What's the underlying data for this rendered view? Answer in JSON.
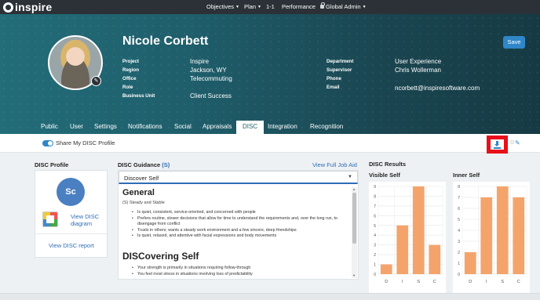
{
  "nav": {
    "logo": "inspire",
    "items": [
      {
        "label": "Objectives",
        "caret": true
      },
      {
        "label": "Plan",
        "caret": true
      },
      {
        "label": "1-1",
        "caret": false
      },
      {
        "label": "Performance",
        "caret": false
      },
      {
        "label": "Global Admin",
        "caret": true
      }
    ]
  },
  "profile": {
    "name": "Nicole Corbett",
    "fields_left": [
      {
        "label": "Project",
        "value": "Inspire"
      },
      {
        "label": "Region",
        "value": "Jackson, WY"
      },
      {
        "label": "Office",
        "value": "Telecommuting"
      },
      {
        "label": "Role",
        "value": ""
      },
      {
        "label": "Business Unit",
        "value": "Client Success"
      }
    ],
    "fields_right": [
      {
        "label": "Department",
        "value": "User Experience"
      },
      {
        "label": "Supervisor",
        "value": "Chris Wollerman"
      },
      {
        "label": "Phone",
        "value": ""
      },
      {
        "label": "Email",
        "value": "ncorbett@inspiresoftware.com"
      }
    ],
    "save_label": "Save"
  },
  "tabs": [
    {
      "label": "Public",
      "active": false
    },
    {
      "label": "User",
      "active": false
    },
    {
      "label": "Settings",
      "active": false
    },
    {
      "label": "Notifications",
      "active": false
    },
    {
      "label": "Social",
      "active": false
    },
    {
      "label": "Appraisals",
      "active": false
    },
    {
      "label": "DISC",
      "active": true
    },
    {
      "label": "Integration",
      "active": false
    },
    {
      "label": "Recognition",
      "active": false
    }
  ],
  "toolbar": {
    "share_label": "Share My DISC Profile",
    "share_on": true,
    "download_icon": "download-icon",
    "edit_icon": "pencil-icon"
  },
  "disc_profile": {
    "title": "DISC Profile",
    "badge": "Sc",
    "view_diagram": "View DISC diagram",
    "view_report": "View DISC report"
  },
  "guidance": {
    "title": "DISC Guidance",
    "title_suffix": "(S)",
    "view_full": "View Full Job Aid",
    "selected": "Discover Self",
    "general_heading": "General",
    "general_sub": "(S) Steady and Stable",
    "general_bullets": [
      "Is quiet, consistent, service-oriented, and concerned with people",
      "Prefers routine, slower decisions that allow for time to understand the requirements and, over the long run, to disengage from conflict",
      "Trusts in others; wants a steady work environment and a few sincere, deep friendships",
      "Is quiet, relaxed, and attentive with facial expressions and body movements"
    ],
    "discovering_heading": "DISCovering Self",
    "discovering_bullets": [
      "Your strength is primarily in situations requiring follow-through",
      "You feel most stress in situations involving loss of predictability"
    ]
  },
  "results": {
    "title": "DISC Results",
    "bar_color": "#f4a46b"
  },
  "chart_data": [
    {
      "type": "bar",
      "title": "Visible Self",
      "categories": [
        "D",
        "I",
        "S",
        "C"
      ],
      "values": [
        1,
        5,
        9,
        3
      ],
      "ylim": [
        0,
        9
      ],
      "yticks": [
        0,
        1,
        2,
        3,
        4,
        5,
        6,
        7,
        8,
        9
      ],
      "grid": true
    },
    {
      "type": "bar",
      "title": "Inner Self",
      "categories": [
        "D",
        "I",
        "S",
        "C"
      ],
      "values": [
        2,
        7,
        8,
        7
      ],
      "ylim": [
        0,
        8
      ],
      "yticks": [
        0,
        1,
        2,
        3,
        4,
        5,
        6,
        7,
        8
      ],
      "grid": true
    }
  ]
}
